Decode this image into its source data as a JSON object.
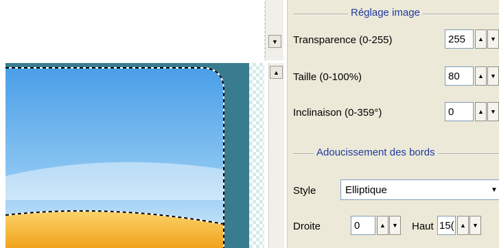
{
  "panel": {
    "group1_title": "Réglage image",
    "transparence": {
      "label": "Transparence (0-255)",
      "value": "255"
    },
    "taille": {
      "label": "Taille (0-100%)",
      "value": "80"
    },
    "inclinaison": {
      "label": "Inclinaison (0-359°)",
      "value": "0"
    },
    "group2_title": "Adoucissement des bords",
    "style": {
      "label": "Style",
      "value": "Elliptique"
    },
    "droite": {
      "label": "Droite",
      "value": "0"
    },
    "haut": {
      "label": "Haut",
      "value": "15("
    }
  },
  "icons": {
    "spin_up": "▲",
    "spin_down": "▼",
    "scroll_up": "▲",
    "scroll_down": "▼",
    "dropdown": "▼"
  },
  "colors": {
    "canvas_bg": "#3a7c8f",
    "sky_top": "#4a9fe8",
    "sky_bottom": "#cfe7f8",
    "sand": "#f4b52e",
    "group_title": "#1e3a9e",
    "panel_bg": "#ece9d8"
  }
}
